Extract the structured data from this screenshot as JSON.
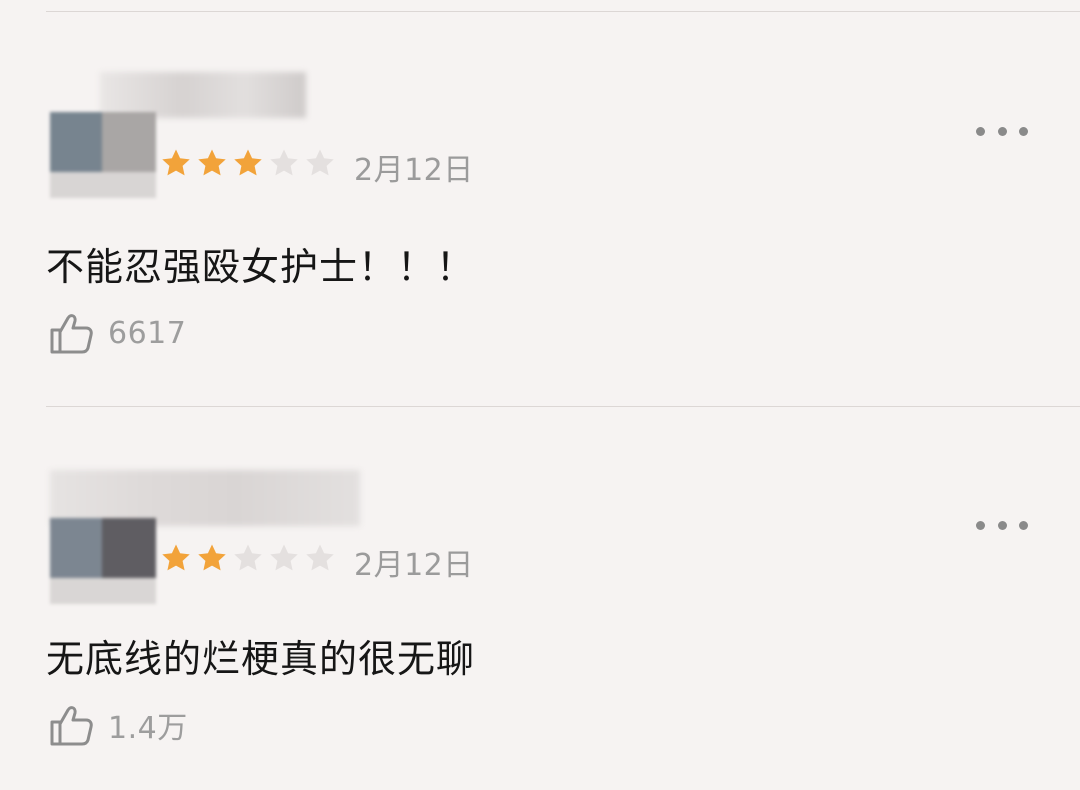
{
  "comments": [
    {
      "rating": 3,
      "max_rating": 5,
      "date": "2月12日",
      "text": "不能忍强殴女护士！！！",
      "likes": "6617"
    },
    {
      "rating": 2,
      "max_rating": 5,
      "date": "2月12日",
      "text": "无底线的烂梗真的很无聊",
      "likes": "1.4万"
    }
  ],
  "colors": {
    "star_filled": "#f2a33a",
    "star_empty": "#e4e0df",
    "muted_text": "#9b9b9b"
  },
  "icons": {
    "more": "more-dots-icon",
    "like": "thumbs-up-icon",
    "star": "star-icon"
  }
}
